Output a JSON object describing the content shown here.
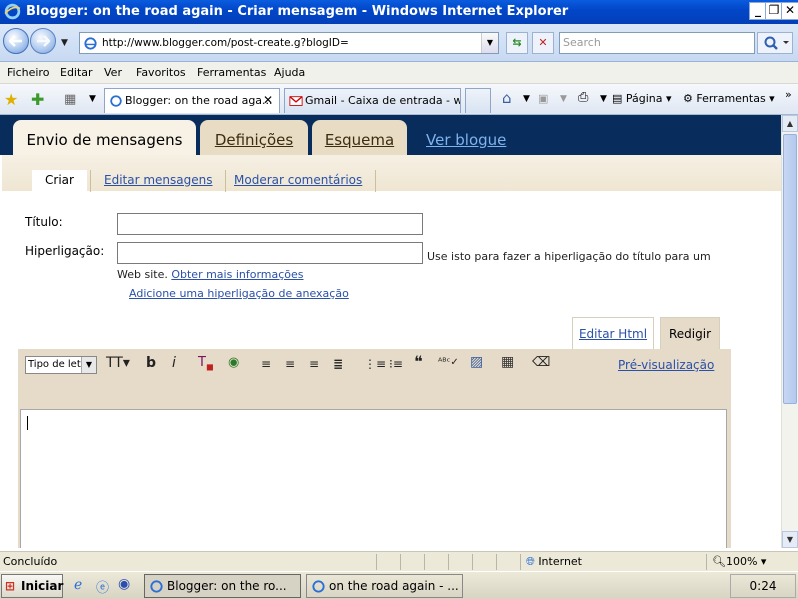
{
  "window": {
    "title": "Blogger: on the road again - Criar mensagem - Windows Internet Explorer",
    "minimize": "_",
    "restore": "❐",
    "close": "✕"
  },
  "address": {
    "url": "http://www.blogger.com/post-create.g?blogID=",
    "search_placeholder": "Search"
  },
  "menu": {
    "items": [
      "Ficheiro",
      "Editar",
      "Ver",
      "Favoritos",
      "Ferramentas",
      "Ajuda"
    ]
  },
  "browser_tabs": [
    {
      "label": "Blogger: on the road aga...",
      "active": true
    },
    {
      "label": "Gmail - Caixa de entrada - w...",
      "active": false
    }
  ],
  "commands": {
    "page": "Página",
    "tools": "Ferramentas"
  },
  "blogger": {
    "tabs": [
      "Envio de mensagens",
      "Definições",
      "Esquema"
    ],
    "view_blog": "Ver blogue",
    "subtabs": [
      "Criar",
      "Editar mensagens",
      "Moderar comentários"
    ],
    "title_label": "Título:",
    "link_label": "Hiperligação:",
    "link_note_part1": "Use isto para fazer a hiperligação do título para um",
    "link_note_part2": "Web site.",
    "more_info": "Obter mais informações",
    "add_attachment": "Adicione uma hiperligação de anexação",
    "edit_html": "Editar Html",
    "compose": "Redigir",
    "font_select": "Tipo de let",
    "preview": "Pré-visualização",
    "title_value": "",
    "link_value": ""
  },
  "toolbar_icons": [
    "font-size-icon",
    "bold-icon",
    "italic-icon",
    "text-color-icon",
    "link-icon",
    "align-left-icon",
    "align-center-icon",
    "align-right-icon",
    "justify-icon",
    "numbered-list-icon",
    "bullet-list-icon",
    "blockquote-icon",
    "spellcheck-icon",
    "image-icon",
    "video-icon",
    "remove-format-icon"
  ],
  "status": {
    "text": "Concluído",
    "zone": "Internet",
    "zoom": "100%"
  },
  "taskbar": {
    "start": "Iniciar",
    "tasks": [
      "Blogger: on the ro...",
      "on the road again - ..."
    ],
    "clock": "0:24"
  },
  "colors": {
    "blogger_header": "#082d5c",
    "tab_active": "#f7f1e6",
    "tab_inactive": "#e8dcc4",
    "link": "#2a50a8",
    "toolbar_bg": "#e6dbc8"
  }
}
